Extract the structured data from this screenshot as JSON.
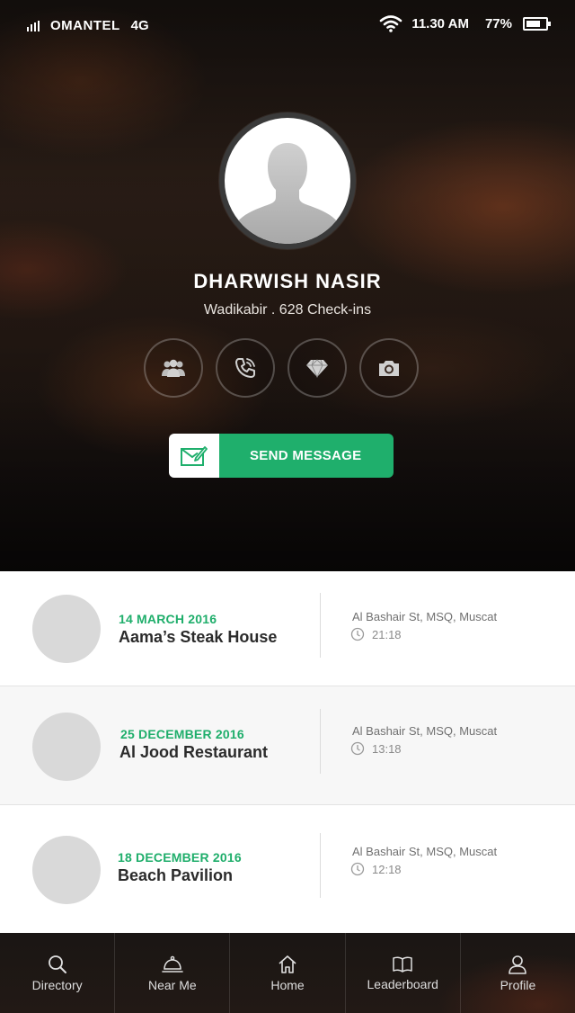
{
  "status_bar": {
    "carrier": "OMANTEL",
    "network": "4G",
    "time": "11.30 AM",
    "battery": "77%",
    "battery_level": 0.77
  },
  "profile": {
    "name": "DHARWISH NASIR",
    "subtitle": "Wadikabir . 628 Check-ins",
    "actions": [
      {
        "icon": "users-icon"
      },
      {
        "icon": "phone-icon"
      },
      {
        "icon": "diamond-icon"
      },
      {
        "icon": "camera-icon"
      }
    ],
    "send_button": {
      "label": "SEND MESSAGE",
      "icon": "compose-message-icon"
    }
  },
  "checkins": [
    {
      "date": "14 MARCH 2016",
      "name": "Aama’s Steak House",
      "address": "Al Bashair St, MSQ, Muscat",
      "time": "21:18"
    },
    {
      "date": "25 DECEMBER 2016",
      "name": "Al Jood Restaurant",
      "address": "Al Bashair St, MSQ, Muscat",
      "time": "13:18"
    },
    {
      "date": "18 DECEMBER 2016",
      "name": "Beach Pavilion",
      "address": "Al Bashair St, MSQ, Muscat",
      "time": "12:18"
    }
  ],
  "tabs": [
    {
      "label": "Directory",
      "icon": "search-icon"
    },
    {
      "label": "Near Me",
      "icon": "cloche-icon"
    },
    {
      "label": "Home",
      "icon": "home-icon"
    },
    {
      "label": "Leaderboard",
      "icon": "book-icon"
    },
    {
      "label": "Profile",
      "icon": "user-icon"
    }
  ],
  "colors": {
    "accent": "#1faf6c",
    "text_dark": "#2b2b2b",
    "thumb": "#d9d9d9"
  }
}
